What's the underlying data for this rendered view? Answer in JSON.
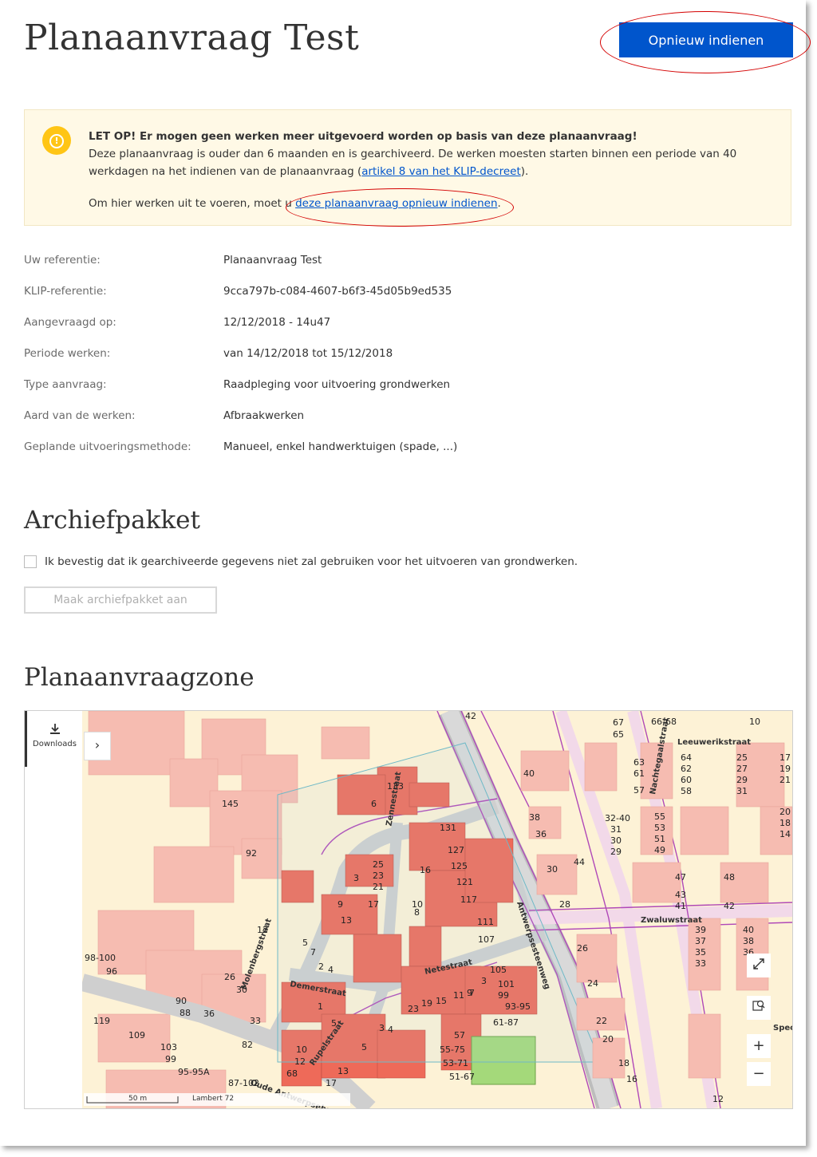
{
  "header": {
    "title": "Planaanvraag Test",
    "resubmit_button": "Opnieuw indienen"
  },
  "alert": {
    "heading": "LET OP! Er mogen geen werken meer uitgevoerd worden op basis van deze planaanvraag!",
    "text_before_link": "Deze planaanvraag is ouder dan 6 maanden en is gearchiveerd. De werken moesten starten binnen een periode van 40 werkdagen na het indienen van de planaanvraag (",
    "link_article": "artikel 8 van het KLIP-decreet",
    "text_after_link": ").",
    "line2_prefix": "Om hier werken uit te voeren, moet u ",
    "link_resubmit": "deze planaanvraag opnieuw indienen",
    "line2_suffix": ".",
    "icon": "warning-icon",
    "color": "#ffc515"
  },
  "details": [
    {
      "label": "Uw referentie:",
      "value": "Planaanvraag Test"
    },
    {
      "label": "KLIP-referentie:",
      "value": "9cca797b-c084-4607-b6f3-45d05b9ed535"
    },
    {
      "label": "Aangevraagd op:",
      "value": "12/12/2018 - 14u47"
    },
    {
      "label": "Periode werken:",
      "value": "van 14/12/2018 tot 15/12/2018"
    },
    {
      "label": "Type aanvraag:",
      "value": "Raadpleging voor uitvoering grondwerken"
    },
    {
      "label": "Aard van de werken:",
      "value": "Afbraakwerken"
    },
    {
      "label": "Geplande uitvoeringsmethode:",
      "value": "Manueel, enkel handwerktuigen (spade, ...)"
    }
  ],
  "archive": {
    "heading": "Archiefpakket",
    "checkbox_label": "Ik bevestig dat ik gearchiveerde gegevens niet zal gebruiken voor het uitvoeren van grondwerken.",
    "checked": false,
    "create_button": "Maak archiefpakket aan"
  },
  "zone": {
    "heading": "Planaanvraagzone",
    "downloads_label": "Downloads",
    "scale_label": "50 m",
    "projection_label": "Lambert 72",
    "streets": [
      "Zennestraat",
      "Netestraat",
      "Demerstraat",
      "Rupelstraat",
      "Molenbergstraat",
      "Antwerpsesteenweg",
      "Zwaluwstraat",
      "Nachtegaalstraat",
      "Leeuwerikstraat",
      "Oude Antwerpsebaan",
      "Speci"
    ],
    "numbers": [
      "133",
      "6",
      "145",
      "92",
      "131",
      "127",
      "125",
      "121",
      "117",
      "111",
      "107",
      "105",
      "101",
      "99",
      "93-95",
      "61-87",
      "57",
      "55-75",
      "53-71",
      "51-67",
      "40",
      "38",
      "36",
      "30",
      "28",
      "44",
      "26",
      "24",
      "22",
      "20",
      "18",
      "16",
      "32-40",
      "31",
      "30",
      "29",
      "55",
      "53",
      "51",
      "49",
      "63",
      "61",
      "57",
      "64",
      "62",
      "60",
      "58",
      "66-68",
      "47",
      "43",
      "41",
      "48",
      "42",
      "39",
      "37",
      "35",
      "33",
      "40",
      "38",
      "36",
      "98-100",
      "96",
      "90",
      "88",
      "109",
      "119",
      "103",
      "99",
      "95-95A",
      "87-102",
      "82",
      "26",
      "30",
      "36",
      "33",
      "12",
      "25",
      "23",
      "21",
      "17",
      "13",
      "9",
      "3",
      "7",
      "5",
      "2",
      "4",
      "10",
      "8",
      "16",
      "23",
      "19",
      "15",
      "11",
      "9",
      "7",
      "3",
      "1",
      "5",
      "10",
      "12",
      "68",
      "17",
      "13",
      "5",
      "4",
      "3",
      "42",
      "67",
      "65",
      "25",
      "27",
      "29",
      "31",
      "17",
      "19",
      "21",
      "20",
      "18",
      "14",
      "10",
      "12"
    ],
    "controls": {
      "fullscreen": "fullscreen-icon",
      "zoom_extent": "zoom-extent-icon",
      "zoom_in": "+",
      "zoom_out": "−"
    }
  },
  "colors": {
    "primary": "#0055cc",
    "annotation": "#d40000",
    "alert_bg": "#fff9e6"
  }
}
